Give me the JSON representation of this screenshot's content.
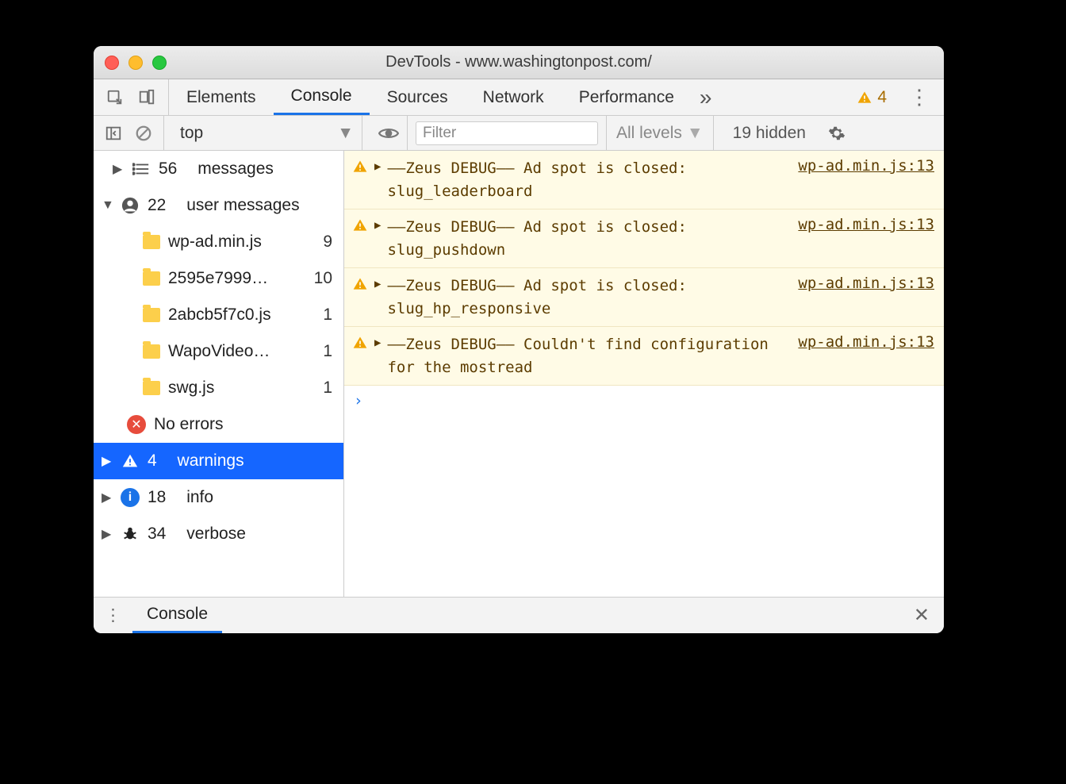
{
  "title": "DevTools - www.washingtonpost.com/",
  "tabs": {
    "elements": "Elements",
    "console": "Console",
    "sources": "Sources",
    "network": "Network",
    "performance": "Performance",
    "more": "»"
  },
  "warn_badge_count": "4",
  "toolbar": {
    "context": "top",
    "filter_placeholder": "Filter",
    "levels": "All levels",
    "hidden": "19 hidden"
  },
  "sidebar": {
    "messages": {
      "count": "56",
      "label": "messages"
    },
    "user": {
      "count": "22",
      "label": "user messages"
    },
    "files": [
      {
        "name": "wp-ad.min.js",
        "count": "9"
      },
      {
        "name": "2595e7999…",
        "count": "10"
      },
      {
        "name": "2abcb5f7c0.js",
        "count": "1"
      },
      {
        "name": "WapoVideo…",
        "count": "1"
      },
      {
        "name": "swg.js",
        "count": "1"
      }
    ],
    "errors": "No errors",
    "warnings": {
      "count": "4",
      "label": "warnings"
    },
    "info": {
      "count": "18",
      "label": "info"
    },
    "verbose": {
      "count": "34",
      "label": "verbose"
    }
  },
  "messages": [
    {
      "text": "––Zeus DEBUG–– Ad spot is closed: slug_leaderboard",
      "src": "wp-ad.min.js:13"
    },
    {
      "text": "––Zeus DEBUG–– Ad spot is closed: slug_pushdown",
      "src": "wp-ad.min.js:13"
    },
    {
      "text": "––Zeus DEBUG–– Ad spot is closed: slug_hp_responsive",
      "src": "wp-ad.min.js:13"
    },
    {
      "text": "––Zeus DEBUG–– Couldn't find configuration for the mostread",
      "src": "wp-ad.min.js:13"
    }
  ],
  "drawer": {
    "console": "Console"
  }
}
